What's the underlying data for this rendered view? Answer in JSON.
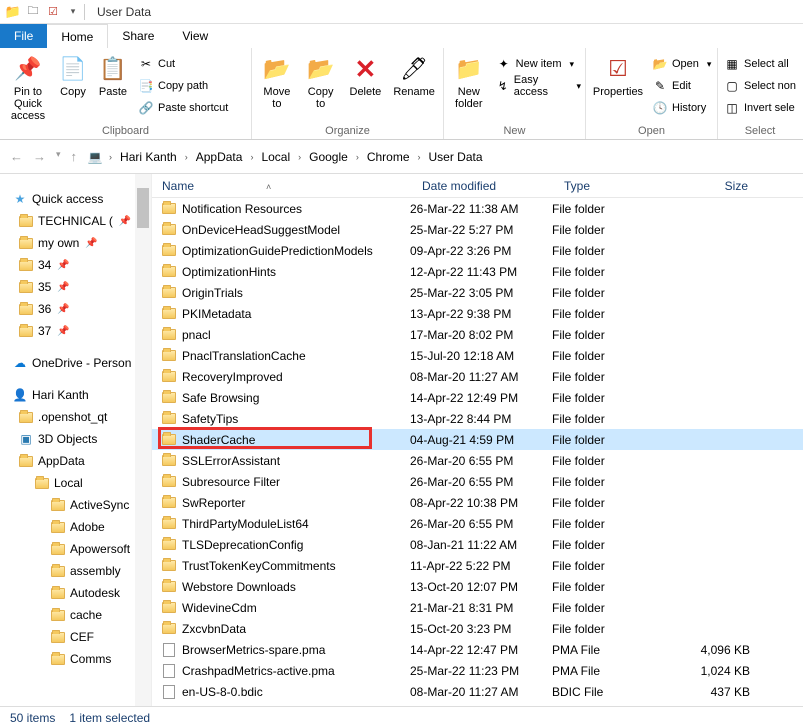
{
  "titlebar": {
    "title": "User Data"
  },
  "tabs": {
    "file": "File",
    "home": "Home",
    "share": "Share",
    "view": "View"
  },
  "ribbon": {
    "clipboard": {
      "label": "Clipboard",
      "pin": "Pin to Quick\naccess",
      "copy": "Copy",
      "paste": "Paste",
      "cut": "Cut",
      "copypath": "Copy path",
      "pasteshortcut": "Paste shortcut"
    },
    "organize": {
      "label": "Organize",
      "moveto": "Move\nto",
      "copyto": "Copy\nto",
      "delete": "Delete",
      "rename": "Rename"
    },
    "new": {
      "label": "New",
      "newfolder": "New\nfolder",
      "newitem": "New item",
      "easyaccess": "Easy access"
    },
    "open": {
      "label": "Open",
      "properties": "Properties",
      "open": "Open",
      "edit": "Edit",
      "history": "History"
    },
    "select": {
      "label": "Select",
      "selectall": "Select all",
      "selectnone": "Select non",
      "invert": "Invert sele"
    }
  },
  "breadcrumb": [
    "Hari Kanth",
    "AppData",
    "Local",
    "Google",
    "Chrome",
    "User Data"
  ],
  "navtree": [
    {
      "label": "Quick access",
      "level": 0,
      "icon": "star"
    },
    {
      "label": "TECHNICAL (",
      "level": 1,
      "icon": "folder",
      "pin": true
    },
    {
      "label": "my own",
      "level": 1,
      "icon": "folder",
      "pin": true
    },
    {
      "label": "34",
      "level": 1,
      "icon": "folder",
      "pin": true
    },
    {
      "label": "35",
      "level": 1,
      "icon": "folder",
      "pin": true
    },
    {
      "label": "36",
      "level": 1,
      "icon": "folder",
      "pin": true
    },
    {
      "label": "37",
      "level": 1,
      "icon": "folder",
      "pin": true
    },
    {
      "label": "OneDrive - Person",
      "level": 0,
      "icon": "cloud",
      "spacer": true
    },
    {
      "label": "Hari Kanth",
      "level": 0,
      "icon": "user",
      "spacer": true
    },
    {
      "label": ".openshot_qt",
      "level": 1,
      "icon": "folder"
    },
    {
      "label": "3D Objects",
      "level": 1,
      "icon": "3d"
    },
    {
      "label": "AppData",
      "level": 1,
      "icon": "folder"
    },
    {
      "label": "Local",
      "level": 2,
      "icon": "folder"
    },
    {
      "label": "ActiveSync",
      "level": 3,
      "icon": "folder"
    },
    {
      "label": "Adobe",
      "level": 3,
      "icon": "folder"
    },
    {
      "label": "Apowersoft",
      "level": 3,
      "icon": "folder"
    },
    {
      "label": "assembly",
      "level": 3,
      "icon": "folder"
    },
    {
      "label": "Autodesk",
      "level": 3,
      "icon": "folder"
    },
    {
      "label": "cache",
      "level": 3,
      "icon": "folder"
    },
    {
      "label": "CEF",
      "level": 3,
      "icon": "folder"
    },
    {
      "label": "Comms",
      "level": 3,
      "icon": "folder"
    }
  ],
  "columns": {
    "name": "Name",
    "date": "Date modified",
    "type": "Type",
    "size": "Size"
  },
  "files": [
    {
      "name": "Notification Resources",
      "date": "26-Mar-22 11:38 AM",
      "type": "File folder",
      "size": "",
      "icon": "folder"
    },
    {
      "name": "OnDeviceHeadSuggestModel",
      "date": "25-Mar-22 5:27 PM",
      "type": "File folder",
      "size": "",
      "icon": "folder"
    },
    {
      "name": "OptimizationGuidePredictionModels",
      "date": "09-Apr-22 3:26 PM",
      "type": "File folder",
      "size": "",
      "icon": "folder"
    },
    {
      "name": "OptimizationHints",
      "date": "12-Apr-22 11:43 PM",
      "type": "File folder",
      "size": "",
      "icon": "folder"
    },
    {
      "name": "OriginTrials",
      "date": "25-Mar-22 3:05 PM",
      "type": "File folder",
      "size": "",
      "icon": "folder"
    },
    {
      "name": "PKIMetadata",
      "date": "13-Apr-22 9:38 PM",
      "type": "File folder",
      "size": "",
      "icon": "folder"
    },
    {
      "name": "pnacl",
      "date": "17-Mar-20 8:02 PM",
      "type": "File folder",
      "size": "",
      "icon": "folder"
    },
    {
      "name": "PnaclTranslationCache",
      "date": "15-Jul-20 12:18 AM",
      "type": "File folder",
      "size": "",
      "icon": "folder"
    },
    {
      "name": "RecoveryImproved",
      "date": "08-Mar-20 11:27 AM",
      "type": "File folder",
      "size": "",
      "icon": "folder"
    },
    {
      "name": "Safe Browsing",
      "date": "14-Apr-22 12:49 PM",
      "type": "File folder",
      "size": "",
      "icon": "folder"
    },
    {
      "name": "SafetyTips",
      "date": "13-Apr-22 8:44 PM",
      "type": "File folder",
      "size": "",
      "icon": "folder"
    },
    {
      "name": "ShaderCache",
      "date": "04-Aug-21 4:59 PM",
      "type": "File folder",
      "size": "",
      "icon": "folder",
      "selected": true,
      "highlight": true
    },
    {
      "name": "SSLErrorAssistant",
      "date": "26-Mar-20 6:55 PM",
      "type": "File folder",
      "size": "",
      "icon": "folder"
    },
    {
      "name": "Subresource Filter",
      "date": "26-Mar-20 6:55 PM",
      "type": "File folder",
      "size": "",
      "icon": "folder"
    },
    {
      "name": "SwReporter",
      "date": "08-Apr-22 10:38 PM",
      "type": "File folder",
      "size": "",
      "icon": "folder"
    },
    {
      "name": "ThirdPartyModuleList64",
      "date": "26-Mar-20 6:55 PM",
      "type": "File folder",
      "size": "",
      "icon": "folder"
    },
    {
      "name": "TLSDeprecationConfig",
      "date": "08-Jan-21 11:22 AM",
      "type": "File folder",
      "size": "",
      "icon": "folder"
    },
    {
      "name": "TrustTokenKeyCommitments",
      "date": "11-Apr-22 5:22 PM",
      "type": "File folder",
      "size": "",
      "icon": "folder"
    },
    {
      "name": "Webstore Downloads",
      "date": "13-Oct-20 12:07 PM",
      "type": "File folder",
      "size": "",
      "icon": "folder"
    },
    {
      "name": "WidevineCdm",
      "date": "21-Mar-21 8:31 PM",
      "type": "File folder",
      "size": "",
      "icon": "folder"
    },
    {
      "name": "ZxcvbnData",
      "date": "15-Oct-20 3:23 PM",
      "type": "File folder",
      "size": "",
      "icon": "folder"
    },
    {
      "name": "BrowserMetrics-spare.pma",
      "date": "14-Apr-22 12:47 PM",
      "type": "PMA File",
      "size": "4,096 KB",
      "icon": "file"
    },
    {
      "name": "CrashpadMetrics-active.pma",
      "date": "25-Mar-22 11:23 PM",
      "type": "PMA File",
      "size": "1,024 KB",
      "icon": "file"
    },
    {
      "name": "en-US-8-0.bdic",
      "date": "08-Mar-20 11:27 AM",
      "type": "BDIC File",
      "size": "437 KB",
      "icon": "file"
    }
  ],
  "status": {
    "count": "50 items",
    "selected": "1 item selected"
  }
}
